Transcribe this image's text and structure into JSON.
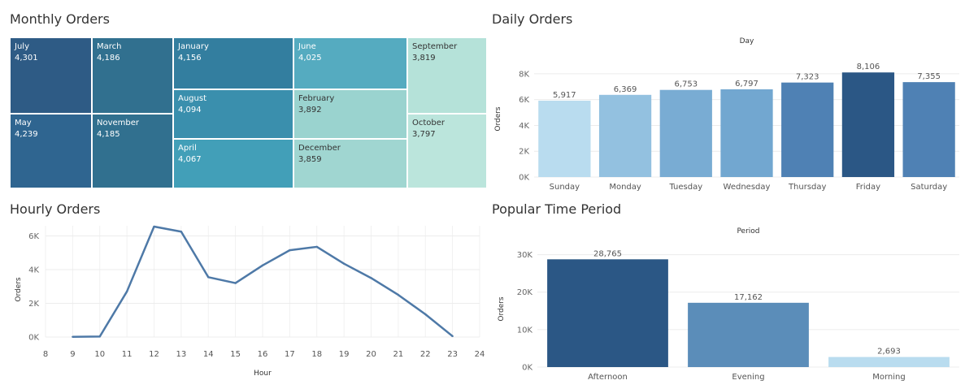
{
  "monthly": {
    "title": "Monthly Orders",
    "chart_data": {
      "type": "treemap",
      "title": "Monthly Orders",
      "items": [
        {
          "label": "July",
          "value": "4,301",
          "color": "#2e5b85",
          "text": "#ffffff"
        },
        {
          "label": "May",
          "value": "4,239",
          "color": "#2f6590",
          "text": "#ffffff"
        },
        {
          "label": "March",
          "value": "4,186",
          "color": "#31708f",
          "text": "#ffffff"
        },
        {
          "label": "November",
          "value": "4,185",
          "color": "#31708f",
          "text": "#ffffff"
        },
        {
          "label": "January",
          "value": "4,156",
          "color": "#337e9f",
          "text": "#ffffff"
        },
        {
          "label": "August",
          "value": "4,094",
          "color": "#3a8fad",
          "text": "#ffffff"
        },
        {
          "label": "April",
          "value": "4,067",
          "color": "#429fb8",
          "text": "#ffffff"
        },
        {
          "label": "June",
          "value": "4,025",
          "color": "#55abc0",
          "text": "#ffffff"
        },
        {
          "label": "February",
          "value": "3,892",
          "color": "#9ad3cf",
          "text": "#333333"
        },
        {
          "label": "December",
          "value": "3,859",
          "color": "#a0d6d1",
          "text": "#333333"
        },
        {
          "label": "September",
          "value": "3,819",
          "color": "#b5e2d9",
          "text": "#333333"
        },
        {
          "label": "October",
          "value": "3,797",
          "color": "#bbe5dc",
          "text": "#333333"
        }
      ]
    }
  },
  "daily": {
    "title": "Daily Orders",
    "chart_data": {
      "type": "bar",
      "title": "Day",
      "ylabel": "Orders",
      "ylim": [
        0,
        9000
      ],
      "yticks": [
        0,
        2000,
        4000,
        6000,
        8000
      ],
      "ytick_labels": [
        "0K",
        "2K",
        "4K",
        "6K",
        "8K"
      ],
      "categories": [
        "Sunday",
        "Monday",
        "Tuesday",
        "Wednesday",
        "Thursday",
        "Friday",
        "Saturday"
      ],
      "values": [
        5917,
        6369,
        6753,
        6797,
        7323,
        8106,
        7355
      ],
      "value_labels": [
        "5,917",
        "6,369",
        "6,753",
        "6,797",
        "7,323",
        "8,106",
        "7,355"
      ],
      "colors": [
        "#b9dcef",
        "#93c1e0",
        "#79acd3",
        "#72a7d0",
        "#4f81b4",
        "#2b5785",
        "#4f81b4"
      ],
      "grid": true
    }
  },
  "hourly": {
    "title": "Hourly Orders",
    "chart_data": {
      "type": "line",
      "xlabel": "Hour",
      "ylabel": "Orders",
      "xlim": [
        8,
        24
      ],
      "xticks": [
        8,
        9,
        10,
        11,
        12,
        13,
        14,
        15,
        16,
        17,
        18,
        19,
        20,
        21,
        22,
        23,
        24
      ],
      "ylim": [
        0,
        6600
      ],
      "yticks": [
        0,
        2000,
        4000,
        6000
      ],
      "ytick_labels": [
        "0K",
        "2K",
        "4K",
        "6K"
      ],
      "x": [
        9,
        10,
        11,
        12,
        13,
        14,
        15,
        16,
        17,
        18,
        19,
        20,
        21,
        22,
        23
      ],
      "y": [
        10,
        30,
        2700,
        6550,
        6250,
        3550,
        3200,
        4250,
        5150,
        5350,
        4350,
        3500,
        2500,
        1350,
        50
      ],
      "color": "#4e79a7",
      "grid": true
    }
  },
  "period": {
    "title": "Popular Time Period",
    "chart_data": {
      "type": "bar",
      "title": "Period",
      "ylabel": "Orders",
      "ylim": [
        0,
        31000
      ],
      "yticks": [
        0,
        10000,
        20000,
        30000
      ],
      "ytick_labels": [
        "0K",
        "10K",
        "20K",
        "30K"
      ],
      "categories": [
        "Afternoon",
        "Evening",
        "Morning"
      ],
      "values": [
        28765,
        17162,
        2693
      ],
      "value_labels": [
        "28,765",
        "17,162",
        "2,693"
      ],
      "colors": [
        "#2b5785",
        "#5b8db9",
        "#b9dcef"
      ],
      "grid": true
    }
  }
}
